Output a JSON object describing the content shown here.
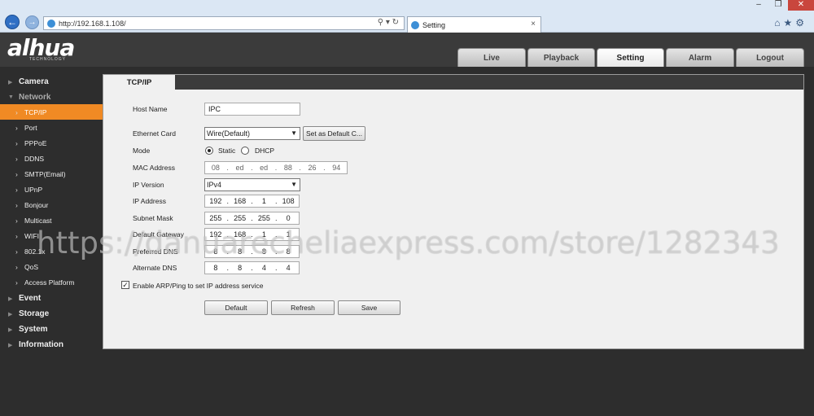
{
  "browser": {
    "url": "http://192.168.1.108/",
    "tab_title": "Setting",
    "tab_close": "×",
    "window_controls": [
      "–",
      "❐",
      "✕"
    ],
    "address_tools": "⚲ ▾ ↻",
    "tools": "⌂★⚙"
  },
  "app": {
    "logo": "alhua",
    "logo_sub": "TECHNOLOGY",
    "top_tabs": [
      "Live",
      "Playback",
      "Setting",
      "Alarm",
      "Logout"
    ],
    "active_top_tab": "Setting"
  },
  "menu": {
    "camera": "Camera",
    "network": "Network",
    "network_items": [
      "TCP/IP",
      "Port",
      "PPPoE",
      "DDNS",
      "SMTP(Email)",
      "UPnP",
      "Bonjour",
      "Multicast",
      "WIFI",
      "802.1x",
      "QoS",
      "Access Platform"
    ],
    "active_item": "TCP/IP",
    "event": "Event",
    "storage": "Storage",
    "system": "System",
    "information": "Information"
  },
  "form": {
    "tab": "TCP/IP",
    "labels": {
      "host_name": "Host Name",
      "ethernet_card": "Ethernet Card",
      "mode": "Mode",
      "mac_address": "MAC Address",
      "ip_version": "IP Version",
      "ip_address": "IP Address",
      "subnet_mask": "Subnet Mask",
      "default_gateway": "Default Gateway",
      "preferred_dns": "Preferred DNS",
      "alternate_dns": "Alternate DNS"
    },
    "host_name": "IPC",
    "ethernet_card": "Wire(Default)",
    "set_default_card": "Set as Default C...",
    "mode_static": "Static",
    "mode_dhcp": "DHCP",
    "mode_selected": "Static",
    "mac_address": [
      "08",
      "ed",
      "ed",
      "88",
      "26",
      "94"
    ],
    "ip_version": "IPv4",
    "ip_address": [
      "192",
      "168",
      "1",
      "108"
    ],
    "subnet_mask": [
      "255",
      "255",
      "255",
      "0"
    ],
    "default_gateway": [
      "192",
      "168",
      "1",
      "1"
    ],
    "preferred_dns": [
      "8",
      "8",
      "8",
      "8"
    ],
    "alternate_dns": [
      "8",
      "8",
      "4",
      "4"
    ],
    "arp_ping_label": "Enable ARP/Ping to set IP address service",
    "arp_ping_checked": true,
    "buttons": {
      "default": "Default",
      "refresh": "Refresh",
      "save": "Save"
    }
  },
  "watermark": "https://danuarecheliaexpress.com/store/1282343"
}
